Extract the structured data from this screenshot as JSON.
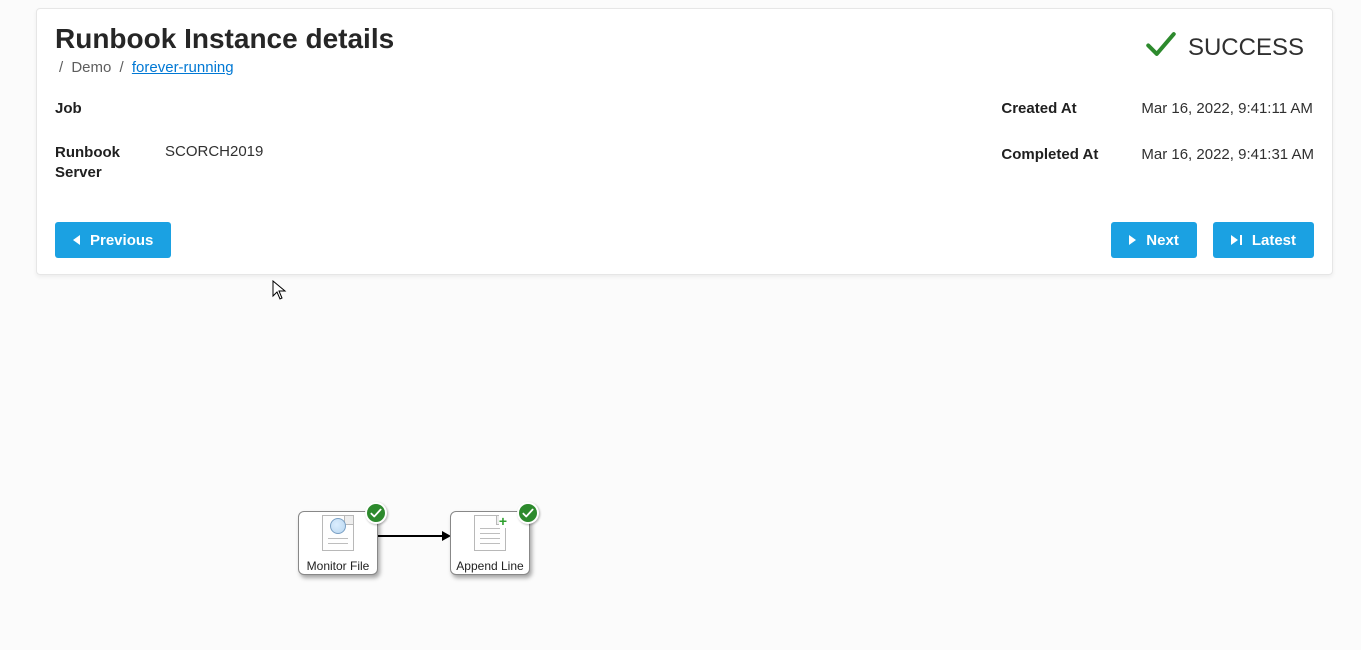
{
  "header": {
    "title": "Runbook Instance details",
    "breadcrumb": {
      "root_sep": "/",
      "item1": "Demo",
      "sep": "/",
      "item2": "forever-running"
    },
    "status": {
      "label": "SUCCESS"
    }
  },
  "details": {
    "job_label": "Job",
    "job_value": "",
    "server_label": "Runbook Server",
    "server_value": "SCORCH2019",
    "created_label": "Created At",
    "created_value": "Mar 16, 2022, 9:41:11 AM",
    "completed_label": "Completed At",
    "completed_value": "Mar 16, 2022, 9:41:31 AM"
  },
  "buttons": {
    "previous": "Previous",
    "next": "Next",
    "latest": "Latest"
  },
  "workflow": {
    "nodes": [
      {
        "name": "Monitor File",
        "status": "success"
      },
      {
        "name": "Append Line",
        "status": "success"
      }
    ]
  }
}
